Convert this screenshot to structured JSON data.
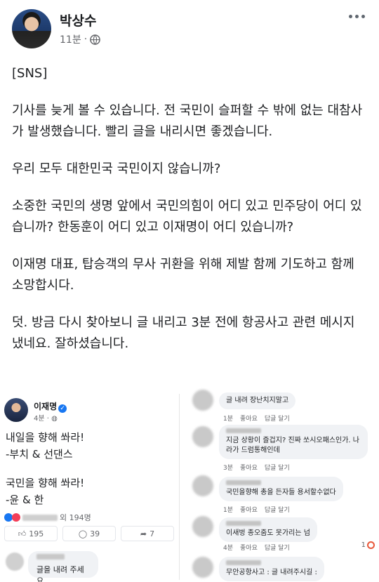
{
  "post": {
    "author": "박상수",
    "time": "11분",
    "separator": "·",
    "paragraphs": [
      "[SNS]",
      "기사를 늦게 볼 수 있습니다. 전 국민이 슬퍼할 수 밖에 없는 대참사가 발생했습니다. 빨리 글을 내리시면 좋겠습니다.",
      "우리 모두 대한민국 국민이지 않습니까?",
      "소중한 국민의 생명 앞에서 국민의힘이 어디 있고 민주당이 어디 있습니까? 한동훈이 어디 있고 이재명이 어디 있습니까?",
      "이재명 대표, 탑승객의 무사 귀환을 위해 제발 함께 기도하고 함께 소망합시다.",
      "덧. 방금 다시 찾아보니 글 내리고 3분 전에 항공사고 관련 메시지 냈네요. 잘하셨습니다."
    ]
  },
  "left_capture": {
    "name": "이재명",
    "verified": "✓",
    "time": "4분 · ",
    "lines": [
      "내일을 향해 쏴라!",
      "-부치 & 선댄스",
      "",
      "국민을 향해 쏴라!",
      "-윤 & 한"
    ],
    "reactions_suffix": "외 194명",
    "like_count": "195",
    "comment_count": "39",
    "share_count": "7",
    "comment_text": "글을 내려 주세요."
  },
  "right_capture": {
    "comments": [
      {
        "text": "글 내려 장난치지말고",
        "time": "1분",
        "like": "좋아요",
        "reply": "답글 달기"
      },
      {
        "text": "지금 상황이 즐겁지? 진짜 쏘시오패스인가. 나라가 드럼통해인데",
        "time": "3분",
        "like": "좋아요",
        "reply": "답글 달기"
      },
      {
        "text": "국민을향해 총을 든자들 용서할수없다",
        "time": "1분",
        "like": "좋아요",
        "reply": "답글 달기"
      },
      {
        "text": "이새벙 종오줌도 못가리는 넘",
        "time": "4분",
        "like": "좋아요",
        "reply": "답글 달기",
        "count": "1"
      },
      {
        "text": "무안공항사고 : 글 내려주시길 :",
        "time": "",
        "like": "",
        "reply": ""
      }
    ]
  }
}
